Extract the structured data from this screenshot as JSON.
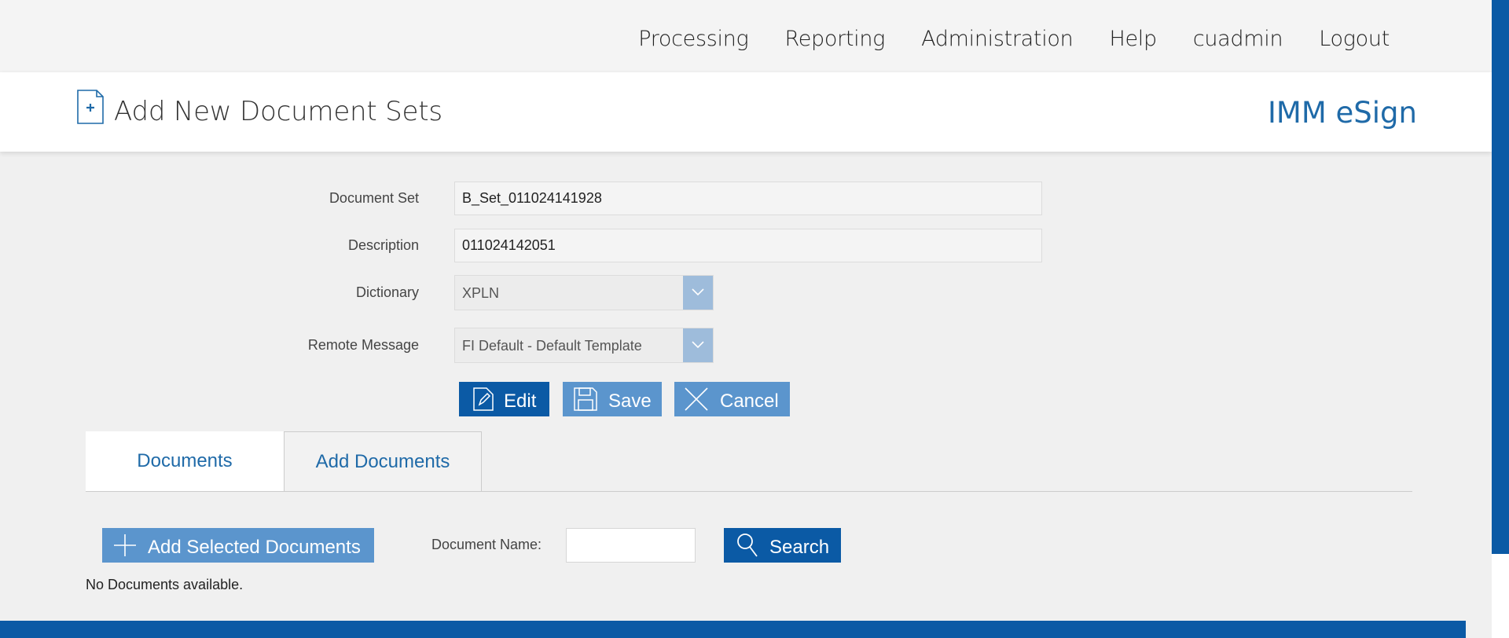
{
  "nav": {
    "items": [
      "Processing",
      "Reporting",
      "Administration",
      "Help",
      "cuadmin",
      "Logout"
    ]
  },
  "header": {
    "title": "Add New Document Sets",
    "brand": "IMM eSign"
  },
  "form": {
    "document_set": {
      "label": "Document Set",
      "value": "B_Set_011024141928"
    },
    "description": {
      "label": "Description",
      "value": "011024142051"
    },
    "dictionary": {
      "label": "Dictionary",
      "value": "XPLN"
    },
    "remote_message": {
      "label": "Remote Message",
      "value": "FI Default - Default Template"
    }
  },
  "actions": {
    "edit": "Edit",
    "save": "Save",
    "cancel": "Cancel"
  },
  "tabs": [
    "Documents",
    "Add Documents"
  ],
  "add_docs": {
    "add_selected": "Add Selected Documents",
    "doc_name_label": "Document Name:",
    "doc_name_value": "",
    "search": "Search",
    "empty": "No Documents available."
  },
  "colors": {
    "primary": "#0b5aa5",
    "secondary": "#5b95cd",
    "brand_text": "#1f6aa8"
  }
}
